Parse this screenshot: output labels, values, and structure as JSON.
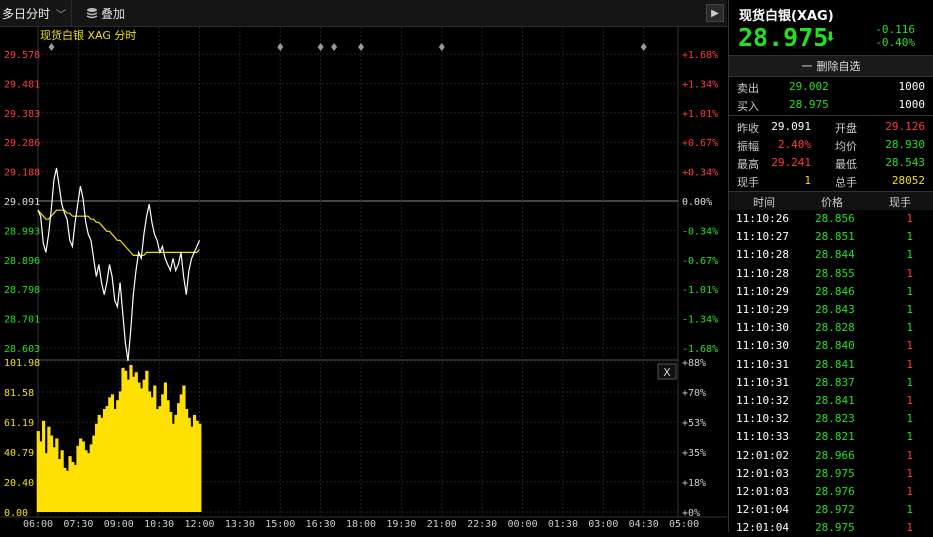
{
  "toolbar": {
    "period_label": "多日分时",
    "overlay_label": "叠加",
    "next_icon": "chevron-right-icon"
  },
  "instrument": {
    "name": "现货白银 XAG",
    "suffix": "分时",
    "legend_color": "#f0e000"
  },
  "panel": {
    "title": "现货白银(XAG)",
    "price": "28.975",
    "change": "-0.116",
    "change_pct": "-0.40%",
    "remove_fav_label": "删除自选",
    "sell_label": "卖出",
    "sell_price": "29.002",
    "sell_vol": "1000",
    "buy_label": "买入",
    "buy_price": "28.975",
    "buy_vol": "1000",
    "stats": [
      {
        "l1": "昨收",
        "v1": "29.091",
        "c1": "wht",
        "l2": "开盘",
        "v2": "29.126",
        "c2": "red"
      },
      {
        "l1": "振幅",
        "v1": "2.40%",
        "c1": "red",
        "l2": "均价",
        "v2": "28.930",
        "c2": "grn"
      },
      {
        "l1": "最高",
        "v1": "29.241",
        "c1": "red",
        "l2": "最低",
        "v2": "28.543",
        "c2": "grn"
      },
      {
        "l1": "现手",
        "v1": "1",
        "c1": "yel",
        "l2": "总手",
        "v2": "28052",
        "c2": "yel"
      }
    ],
    "ticks_header": {
      "time": "时间",
      "price": "价格",
      "vol": "现手"
    },
    "ticks": [
      {
        "time": "11:10:26",
        "price": "28.856",
        "vol": "1",
        "vc": "red"
      },
      {
        "time": "11:10:27",
        "price": "28.851",
        "vol": "1",
        "vc": "grn"
      },
      {
        "time": "11:10:28",
        "price": "28.844",
        "vol": "1",
        "vc": "grn"
      },
      {
        "time": "11:10:28",
        "price": "28.855",
        "vol": "1",
        "vc": "red"
      },
      {
        "time": "11:10:29",
        "price": "28.846",
        "vol": "1",
        "vc": "grn"
      },
      {
        "time": "11:10:29",
        "price": "28.843",
        "vol": "1",
        "vc": "grn"
      },
      {
        "time": "11:10:30",
        "price": "28.828",
        "vol": "1",
        "vc": "grn"
      },
      {
        "time": "11:10:30",
        "price": "28.840",
        "vol": "1",
        "vc": "red"
      },
      {
        "time": "11:10:31",
        "price": "28.841",
        "vol": "1",
        "vc": "red"
      },
      {
        "time": "11:10:31",
        "price": "28.837",
        "vol": "1",
        "vc": "grn"
      },
      {
        "time": "11:10:32",
        "price": "28.841",
        "vol": "1",
        "vc": "red"
      },
      {
        "time": "11:10:32",
        "price": "28.823",
        "vol": "1",
        "vc": "grn"
      },
      {
        "time": "11:10:33",
        "price": "28.821",
        "vol": "1",
        "vc": "grn"
      },
      {
        "time": "12:01:02",
        "price": "28.966",
        "vol": "1",
        "vc": "red"
      },
      {
        "time": "12:01:03",
        "price": "28.975",
        "vol": "1",
        "vc": "red"
      },
      {
        "time": "12:01:03",
        "price": "28.976",
        "vol": "1",
        "vc": "red"
      },
      {
        "time": "12:01:04",
        "price": "28.972",
        "vol": "1",
        "vc": "grn"
      },
      {
        "time": "12:01:04",
        "price": "28.975",
        "vol": "1",
        "vc": "red"
      }
    ]
  },
  "chart_data": {
    "type": "line",
    "title": "现货白银 XAG 分时",
    "x_ticks": [
      "06:00",
      "07:30",
      "09:00",
      "10:30",
      "12:00",
      "13:30",
      "15:00",
      "16:30",
      "18:00",
      "19:30",
      "21:00",
      "22:30",
      "00:00",
      "01:30",
      "03:00",
      "04:30",
      "05:00"
    ],
    "x_range": [
      "06:00",
      "05:00"
    ],
    "y_price_ticks": [
      "29.578",
      "29.481",
      "29.383",
      "29.286",
      "29.188",
      "29.091",
      "28.993",
      "28.896",
      "28.798",
      "28.701",
      "28.603"
    ],
    "y_pct_ticks": [
      "+1.68%",
      "+1.34%",
      "+1.01%",
      "+0.67%",
      "+0.34%",
      "0.00%",
      "-0.34%",
      "-0.67%",
      "-1.01%",
      "-1.34%",
      "-1.68%"
    ],
    "prev_close": 29.091,
    "ylim": [
      28.603,
      29.578
    ],
    "volume_ticks": [
      "101.98",
      "81.58",
      "61.19",
      "40.79",
      "20.40",
      "0.00"
    ],
    "volume_pct_ticks": [
      "+88%",
      "+70%",
      "+53%",
      "+35%",
      "+18%",
      "+0%"
    ],
    "volume_ylim": [
      0,
      101.98
    ],
    "volume_close_label": "X",
    "colors": {
      "price": "#ffffff",
      "avg": "#f0e000",
      "volume": "#ffe000",
      "up": "#ff3b3b",
      "down": "#22e022"
    },
    "series": [
      {
        "values": [
          29.06,
          29.04,
          28.95,
          28.92,
          28.98,
          29.06,
          29.16,
          29.2,
          29.14,
          29.08,
          29.05,
          29.03,
          28.96,
          28.94,
          29.02,
          29.08,
          29.14,
          29.1,
          29.02,
          28.98,
          28.96,
          28.9,
          28.84,
          28.88,
          28.82,
          28.78,
          28.82,
          28.88,
          28.84,
          28.76,
          28.74,
          28.82,
          28.72,
          28.62,
          28.56,
          28.66,
          28.78,
          28.86,
          28.92,
          28.9,
          28.98,
          29.04,
          29.08,
          29.02,
          28.98,
          28.96,
          28.92,
          28.94,
          28.9,
          28.88,
          28.86,
          28.9,
          28.86,
          28.88,
          28.92,
          28.84,
          28.78,
          28.86,
          28.9,
          28.92,
          28.94,
          28.96
        ]
      },
      {
        "values": [
          29.06,
          29.05,
          29.04,
          29.03,
          29.03,
          29.04,
          29.05,
          29.06,
          29.06,
          29.06,
          29.06,
          29.05,
          29.05,
          29.04,
          29.04,
          29.04,
          29.04,
          29.04,
          29.04,
          29.04,
          29.03,
          29.03,
          29.02,
          29.02,
          29.01,
          29.0,
          28.99,
          28.99,
          28.98,
          28.97,
          28.96,
          28.96,
          28.95,
          28.94,
          28.93,
          28.92,
          28.91,
          28.91,
          28.91,
          28.91,
          28.91,
          28.92,
          28.92,
          28.92,
          28.92,
          28.92,
          28.92,
          28.92,
          28.92,
          28.92,
          28.92,
          28.92,
          28.92,
          28.92,
          28.92,
          28.92,
          28.92,
          28.92,
          28.92,
          28.92,
          28.92,
          28.93
        ]
      }
    ],
    "volume": [
      55,
      48,
      62,
      40,
      58,
      52,
      44,
      50,
      36,
      42,
      30,
      28,
      38,
      34,
      32,
      45,
      50,
      48,
      42,
      40,
      46,
      52,
      60,
      66,
      64,
      70,
      72,
      78,
      80,
      70,
      76,
      82,
      98,
      96,
      90,
      100,
      92,
      95,
      88,
      84,
      90,
      96,
      82,
      78,
      86,
      70,
      72,
      80,
      88,
      76,
      68,
      60,
      66,
      74,
      80,
      86,
      70,
      64,
      58,
      66,
      62,
      60
    ],
    "markers": [
      "06:30",
      "15:00",
      "16:30",
      "17:00",
      "18:00",
      "21:00",
      "04:30"
    ]
  }
}
